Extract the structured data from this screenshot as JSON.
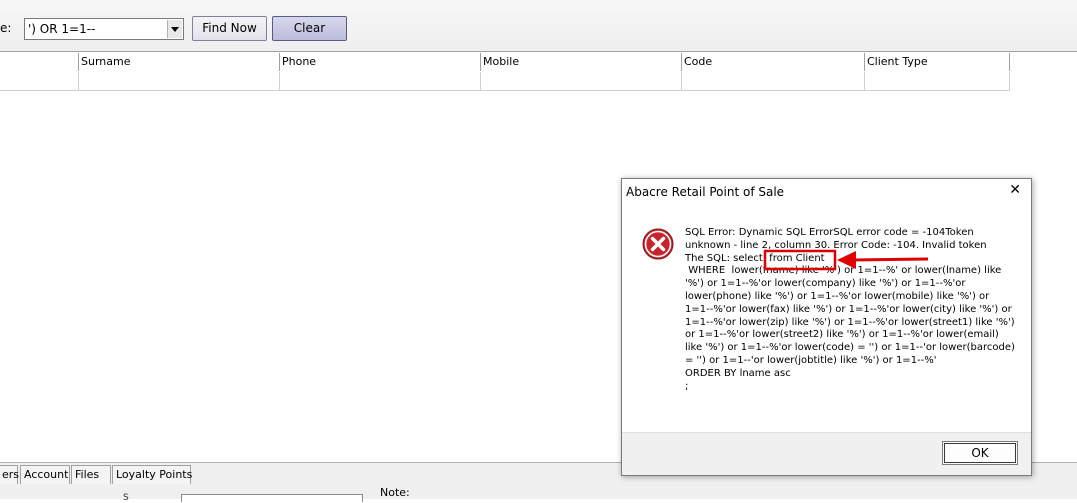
{
  "toolbar": {
    "search_label": "e:",
    "search_value": "') OR 1=1--",
    "find_label": "Find Now",
    "clear_label": "Clear"
  },
  "grid": {
    "headers": [
      "",
      "Surname",
      "Phone",
      "Mobile",
      "Code",
      "Client Type"
    ]
  },
  "tabs": [
    "ers",
    "Account",
    "Files",
    "Loyalty Points"
  ],
  "bottom": {
    "note_label": "Note:",
    "small_label": "S"
  },
  "dialog": {
    "title": "Abacre Retail Point of Sale",
    "close_glyph": "✕",
    "message": "SQL Error: Dynamic SQL ErrorSQL error code = -104Token unknown - line 2, column 30. Error Code: -104. Invalid token\nThe SQL: select  from Client\n WHERE  lower(fname) like '%') or 1=1--%' or lower(lname) like '%') or 1=1--%'or lower(company) like '%') or 1=1--%'or lower(phone) like '%') or 1=1--%'or lower(mobile) like '%') or 1=1--%'or lower(fax) like '%') or 1=1--%'or lower(city) like '%') or 1=1--%'or lower(zip) like '%') or 1=1--%'or lower(street1) like '%') or 1=1--%'or lower(street2) like '%') or 1=1--%'or lower(email) like '%') or 1=1--%'or lower(code) = '') or 1=1--'or lower(barcode) = '') or 1=1--'or lower(jobtitle) like '%') or 1=1--%'\nORDER BY lname asc\n;",
    "ok_label": "OK"
  },
  "colors": {
    "annotation": "#e00000",
    "error_icon": "#c8242b"
  }
}
